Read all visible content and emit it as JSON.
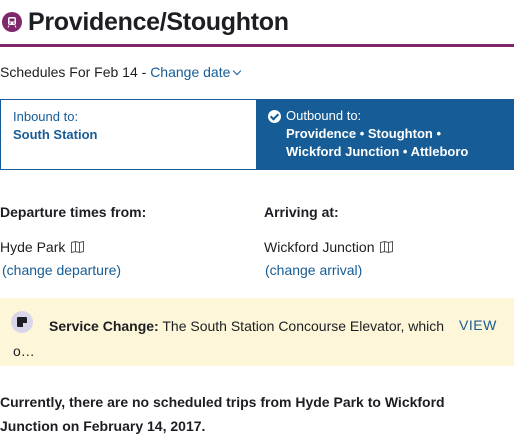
{
  "header": {
    "title": "Providence/Stoughton",
    "icon": "commuter-rail-icon",
    "accent_color": "#80276c"
  },
  "schedule": {
    "prefix": "Schedules For Feb 14 - ",
    "change_date_label": "Change date"
  },
  "direction": {
    "inbound_label": "Inbound to:",
    "inbound_destination": "South Station",
    "outbound_label": "Outbound to:",
    "outbound_destination_line1": "Providence • Stoughton •",
    "outbound_destination_line2": "Wickford Junction • Attleboro",
    "selected": "outbound",
    "active_color": "#165c96"
  },
  "departure": {
    "heading": "Departure times from:",
    "stop": "Hyde Park",
    "change_label": "(change departure)"
  },
  "arrival": {
    "heading": "Arriving at:",
    "stop": "Wickford Junction",
    "change_label": "(change arrival)"
  },
  "alert": {
    "type": "Service Change:",
    "message": " The South Station Concourse Elevator, which o…",
    "view_label": "VIEW",
    "background": "#fdf6d8"
  },
  "notice": "Currently, there are no scheduled trips from Hyde Park to Wickford Junction on February 14, 2017."
}
